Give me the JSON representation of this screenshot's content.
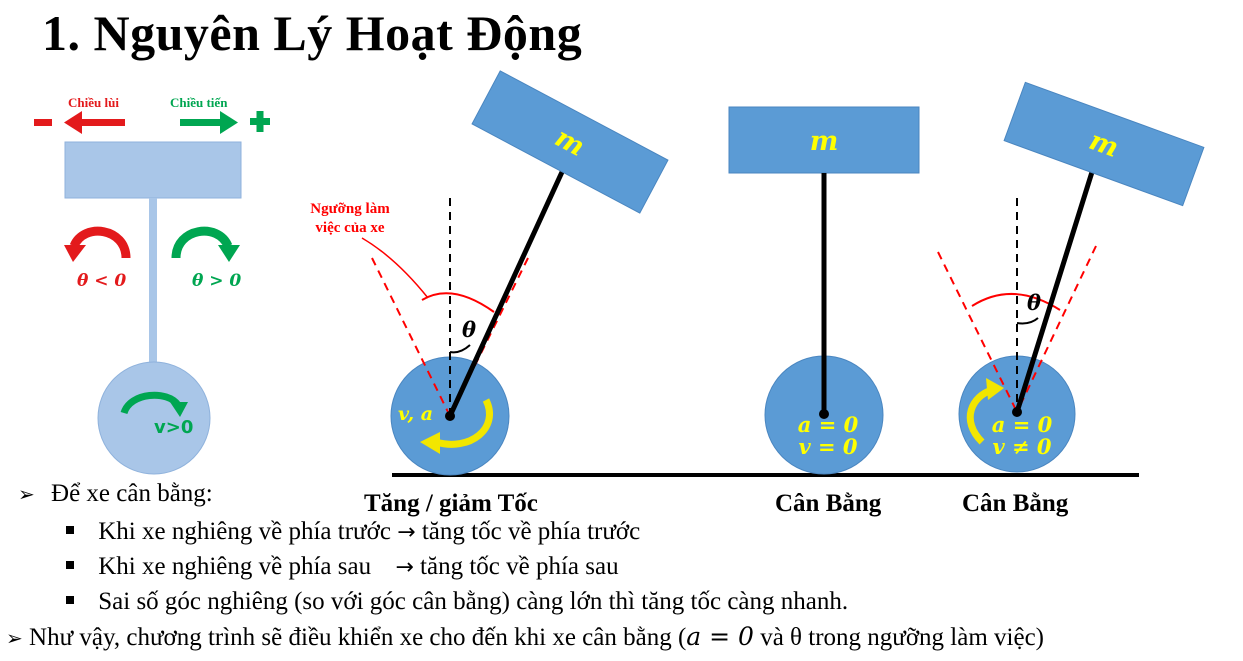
{
  "title": "1. Nguyên Lý Hoạt Động",
  "legend": {
    "backward_label": "Chiều lùi",
    "forward_label": "Chiều tiến",
    "minus_sign": "−",
    "plus_sign": "+",
    "theta_negative": "θ < 0",
    "theta_positive": "θ > 0",
    "wheel_velocity": "v>0",
    "colors": {
      "red": "#e31a1c",
      "green": "#00a651",
      "light_blue": "#a9c6e8",
      "blue": "#5b9bd5"
    }
  },
  "diagram": {
    "mass_label": "m",
    "threshold_label_line1": "Ngưỡng làm",
    "threshold_label_line2": "việc của xe",
    "theta": "θ",
    "wheel1_label": "v, a",
    "wheel2_line1": "a = 0",
    "wheel2_line2": "v = 0",
    "wheel3_line1": "a = 0",
    "wheel3_line2": "v ≠ 0",
    "colors": {
      "mass": "#5b9bd5",
      "label_yellow": "#ffff00",
      "rod": "#000000",
      "threshold": "#ff0000",
      "arc_arrow": "#f2e600"
    }
  },
  "captions": {
    "accel": "Tăng / giảm Tốc",
    "balance1": "Cân Bằng",
    "balance2": "Cân Bằng"
  },
  "bullets": {
    "b1_marker": "➢",
    "b1_text": "Để xe cân bằng:",
    "sub1_text": "Khi xe nghiêng về phía trước",
    "sub1_arrow": "→",
    "sub1_result": "tăng tốc về phía trước",
    "sub2_text": "Khi xe nghiêng về phía sau",
    "sub2_arrow": "→",
    "sub2_result": "tăng tốc về phía sau",
    "sub3_text": "Sai số góc nghiêng (so với góc cân bằng) càng lớn thì tăng tốc càng nhanh.",
    "b2_marker": "➢",
    "b2_text_before": "Như vậy, chương trình sẽ điều khiển xe cho đến khi xe cân bằng (",
    "b2_math": "a = 0",
    "b2_text_after": " và θ trong ngưỡng làm việc)"
  }
}
